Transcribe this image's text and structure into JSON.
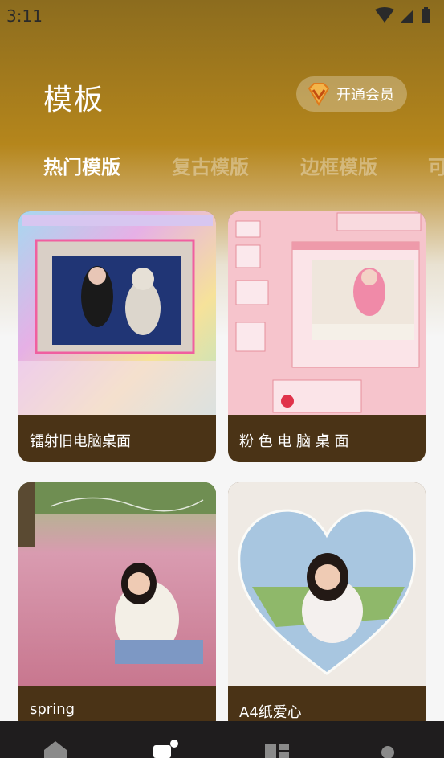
{
  "status_bar": {
    "time": "3:11"
  },
  "header": {
    "title": "模板",
    "vip_label": "开通会员"
  },
  "tabs": [
    {
      "label": "热门模版",
      "active": true
    },
    {
      "label": "复古模版",
      "active": false
    },
    {
      "label": "边框模版",
      "active": false
    },
    {
      "label": "可",
      "active": false
    }
  ],
  "cards": [
    {
      "label": "镭射旧电脑桌面"
    },
    {
      "label": "粉 色 电 脑 桌 面"
    },
    {
      "label": "spring"
    },
    {
      "label": "A4纸爱心"
    }
  ],
  "bottom_nav": {
    "items": [
      "home-icon",
      "templates-icon",
      "layout-icon",
      "profile-icon"
    ],
    "active": "templates-icon"
  },
  "colors": {
    "card_footer": "#4a3316",
    "accent_gold": "#b5861c",
    "nav_bar": "#1f1d1e"
  }
}
